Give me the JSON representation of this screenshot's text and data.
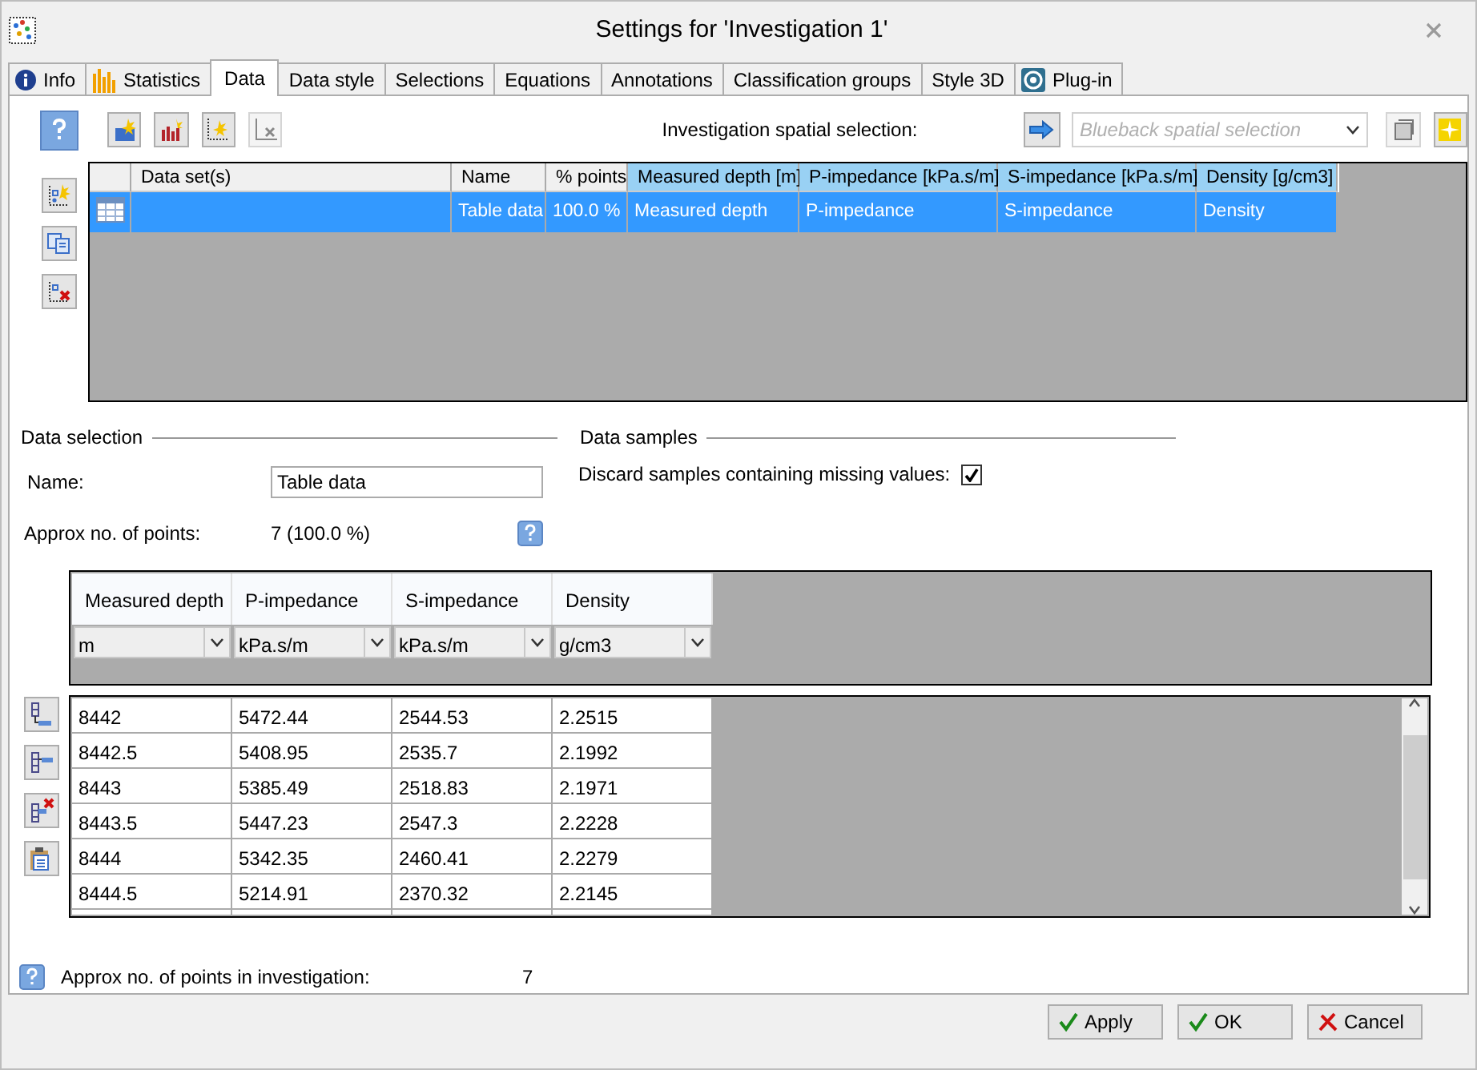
{
  "window": {
    "title": "Settings for 'Investigation 1'"
  },
  "tabs": [
    {
      "label": "Info",
      "kind": "info",
      "selected": false
    },
    {
      "label": "Statistics",
      "kind": "chart",
      "selected": false
    },
    {
      "label": "Data",
      "kind": "plain",
      "selected": true
    },
    {
      "label": "Data style",
      "kind": "plain",
      "selected": false
    },
    {
      "label": "Selections",
      "kind": "plain",
      "selected": false
    },
    {
      "label": "Equations",
      "kind": "plain",
      "selected": false
    },
    {
      "label": "Annotations",
      "kind": "plain",
      "selected": false
    },
    {
      "label": "Classification groups",
      "kind": "plain",
      "selected": false
    },
    {
      "label": "Style 3D",
      "kind": "plain",
      "selected": false
    },
    {
      "label": "Plug-in",
      "kind": "plugin",
      "selected": false
    }
  ],
  "spatial_selection": {
    "label": "Investigation spatial selection:",
    "placeholder": "Blueback spatial selection",
    "disabled": true
  },
  "datasets": {
    "columns": [
      {
        "label": "Data set(s)",
        "selected": false
      },
      {
        "label": "Name",
        "selected": false
      },
      {
        "label": "% points",
        "selected": false
      },
      {
        "label": "Measured depth [m]",
        "selected": true
      },
      {
        "label": "P-impedance [kPa.s/m]",
        "selected": true
      },
      {
        "label": "S-impedance [kPa.s/m]",
        "selected": true
      },
      {
        "label": "Density [g/cm3]",
        "selected": true
      }
    ],
    "rows": [
      {
        "selected": true,
        "name": "Table data",
        "points": "100.0 %",
        "mappings": [
          "Measured depth",
          "P-impedance",
          "S-impedance",
          "Density"
        ]
      }
    ]
  },
  "data_selection": {
    "heading": "Data selection",
    "name_label": "Name:",
    "name_value": "Table data",
    "points_label": "Approx no. of points:",
    "points_value": "7 (100.0 %)"
  },
  "data_samples": {
    "heading": "Data samples",
    "discard_label": "Discard samples containing missing values:",
    "discard_checked": true
  },
  "units_grid": {
    "columns": [
      {
        "name": "Measured depth",
        "unit": "m"
      },
      {
        "name": "P-impedance",
        "unit": "kPa.s/m"
      },
      {
        "name": "S-impedance",
        "unit": "kPa.s/m"
      },
      {
        "name": "Density",
        "unit": "g/cm3"
      }
    ]
  },
  "values": {
    "rows": [
      [
        "8442",
        "5472.44",
        "2544.53",
        "2.2515"
      ],
      [
        "8442.5",
        "5408.95",
        "2535.7",
        "2.1992"
      ],
      [
        "8443",
        "5385.49",
        "2518.83",
        "2.1971"
      ],
      [
        "8443.5",
        "5447.23",
        "2547.3",
        "2.2228"
      ],
      [
        "8444",
        "5342.35",
        "2460.41",
        "2.2279"
      ],
      [
        "8444.5",
        "5214.91",
        "2370.32",
        "2.2145"
      ]
    ]
  },
  "investigation_points": {
    "label": "Approx no. of points in investigation:",
    "value": "7"
  },
  "buttons": [
    {
      "label": "Apply",
      "kind": "ok"
    },
    {
      "label": "OK",
      "kind": "ok"
    },
    {
      "label": "Cancel",
      "kind": "cancel"
    }
  ]
}
